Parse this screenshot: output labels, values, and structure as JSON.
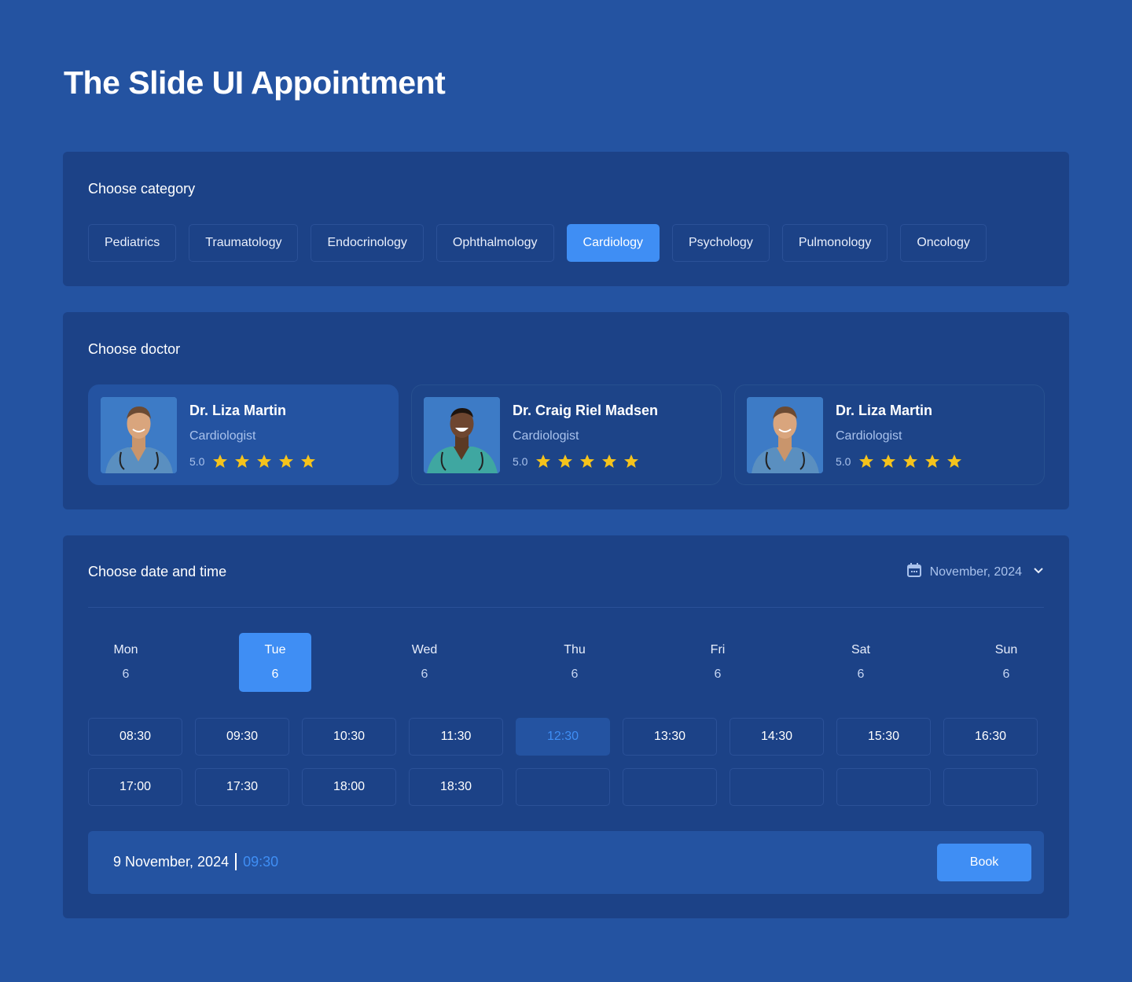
{
  "page": {
    "title": "The Slide UI Appointment"
  },
  "category": {
    "title": "Choose category",
    "items": [
      "Pediatrics",
      "Traumatology",
      "Endocrinology",
      "Ophthalmology",
      "Cardiology",
      "Psychology",
      "Pulmonology",
      "Oncology"
    ],
    "active": "Cardiology"
  },
  "doctor": {
    "title": "Choose doctor",
    "cards": [
      {
        "name": "Dr. Liza Martin",
        "specialty": "Cardiologist",
        "rating": "5.0",
        "stars": 5,
        "active": true
      },
      {
        "name": "Dr. Craig Riel Madsen",
        "specialty": "Cardiologist",
        "rating": "5.0",
        "stars": 5,
        "active": false
      },
      {
        "name": "Dr. Liza Martin",
        "specialty": "Cardiologist",
        "rating": "5.0",
        "stars": 5,
        "active": false
      }
    ]
  },
  "datetime": {
    "title": "Choose date and time",
    "month": "November, 2024",
    "days": [
      {
        "name": "Mon",
        "num": "6"
      },
      {
        "name": "Tue",
        "num": "6"
      },
      {
        "name": "Wed",
        "num": "6"
      },
      {
        "name": "Thu",
        "num": "6"
      },
      {
        "name": "Fri",
        "num": "6"
      },
      {
        "name": "Sat",
        "num": "6"
      },
      {
        "name": "Sun",
        "num": "6"
      }
    ],
    "active_day": "Tue",
    "slots": [
      "08:30",
      "09:30",
      "10:30",
      "11:30",
      "12:30",
      "13:30",
      "14:30",
      "15:30",
      "16:30",
      "17:00",
      "17:30",
      "18:00",
      "18:30",
      "",
      "",
      "",
      "",
      ""
    ],
    "active_slot": "12:30"
  },
  "summary": {
    "date": "9 November, 2024",
    "time": "09:30",
    "book_label": "Book"
  },
  "colors": {
    "background": "#2453a1",
    "panel": "#1c4287",
    "accent": "#3f8ef4",
    "star": "#f5c31c"
  }
}
